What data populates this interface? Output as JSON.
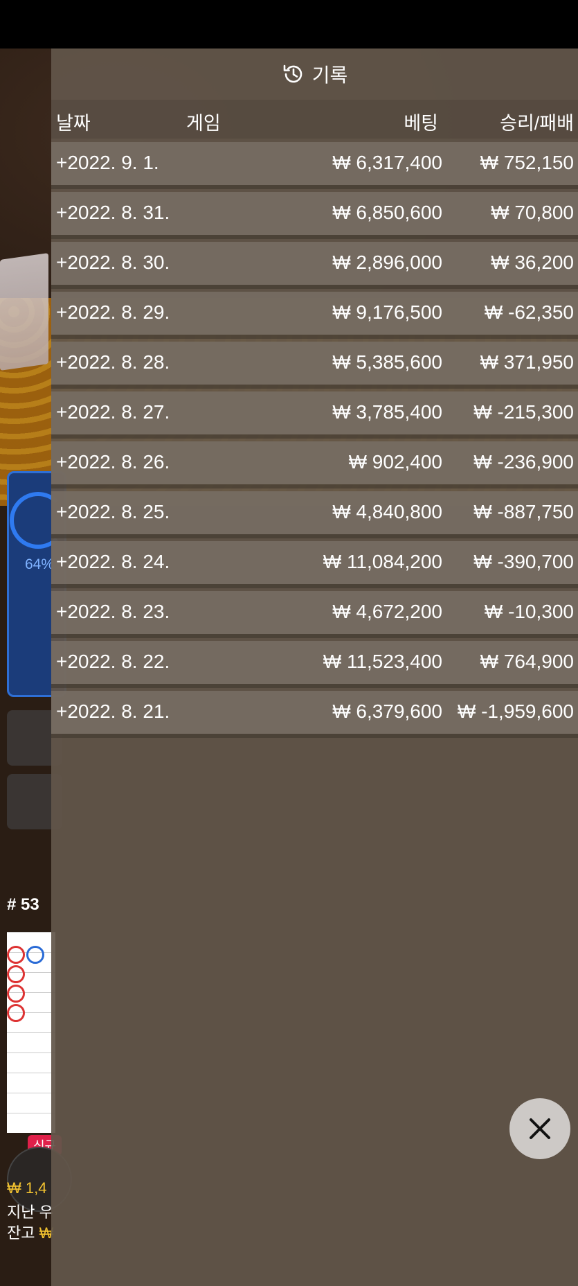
{
  "header": {
    "title": "기록"
  },
  "columns": {
    "date": "날짜",
    "game": "게임",
    "bet": "베팅",
    "win_loss": "승리/패배"
  },
  "rows": [
    {
      "date": "+2022. 9. 1.",
      "bet": "₩ 6,317,400",
      "win_loss": "₩ 752,150"
    },
    {
      "date": "+2022. 8. 31.",
      "bet": "₩ 6,850,600",
      "win_loss": "₩ 70,800"
    },
    {
      "date": "+2022. 8. 30.",
      "bet": "₩ 2,896,000",
      "win_loss": "₩ 36,200"
    },
    {
      "date": "+2022. 8. 29.",
      "bet": "₩ 9,176,500",
      "win_loss": "₩ -62,350"
    },
    {
      "date": "+2022. 8. 28.",
      "bet": "₩ 5,385,600",
      "win_loss": "₩ 371,950"
    },
    {
      "date": "+2022. 8. 27.",
      "bet": "₩ 3,785,400",
      "win_loss": "₩ -215,300"
    },
    {
      "date": "+2022. 8. 26.",
      "bet": "₩ 902,400",
      "win_loss": "₩ -236,900"
    },
    {
      "date": "+2022. 8. 25.",
      "bet": "₩ 4,840,800",
      "win_loss": "₩ -887,750"
    },
    {
      "date": "+2022. 8. 24.",
      "bet": "₩ 11,084,200",
      "win_loss": "₩ -390,700"
    },
    {
      "date": "+2022. 8. 23.",
      "bet": "₩ 4,672,200",
      "win_loss": "₩ -10,300"
    },
    {
      "date": "+2022. 8. 22.",
      "bet": "₩ 11,523,400",
      "win_loss": "₩ 764,900"
    },
    {
      "date": "+2022. 8. 21.",
      "bet": "₩ 6,379,600",
      "win_loss": "₩ -1,959,600"
    }
  ],
  "background": {
    "round_number": "# 53",
    "progress_label": "64%",
    "new_badge": "신규",
    "bottom_line1": "₩ 1,4",
    "bottom_line2": "지난 우",
    "bottom_line3_label": "잔고",
    "bottom_line3_value": "₩",
    "colors": {
      "accent": "#f2c230",
      "panel_blue": "#2e6fd6",
      "badge": "#e0204a"
    }
  },
  "icons": {
    "history": "history-icon",
    "close": "close-icon"
  }
}
